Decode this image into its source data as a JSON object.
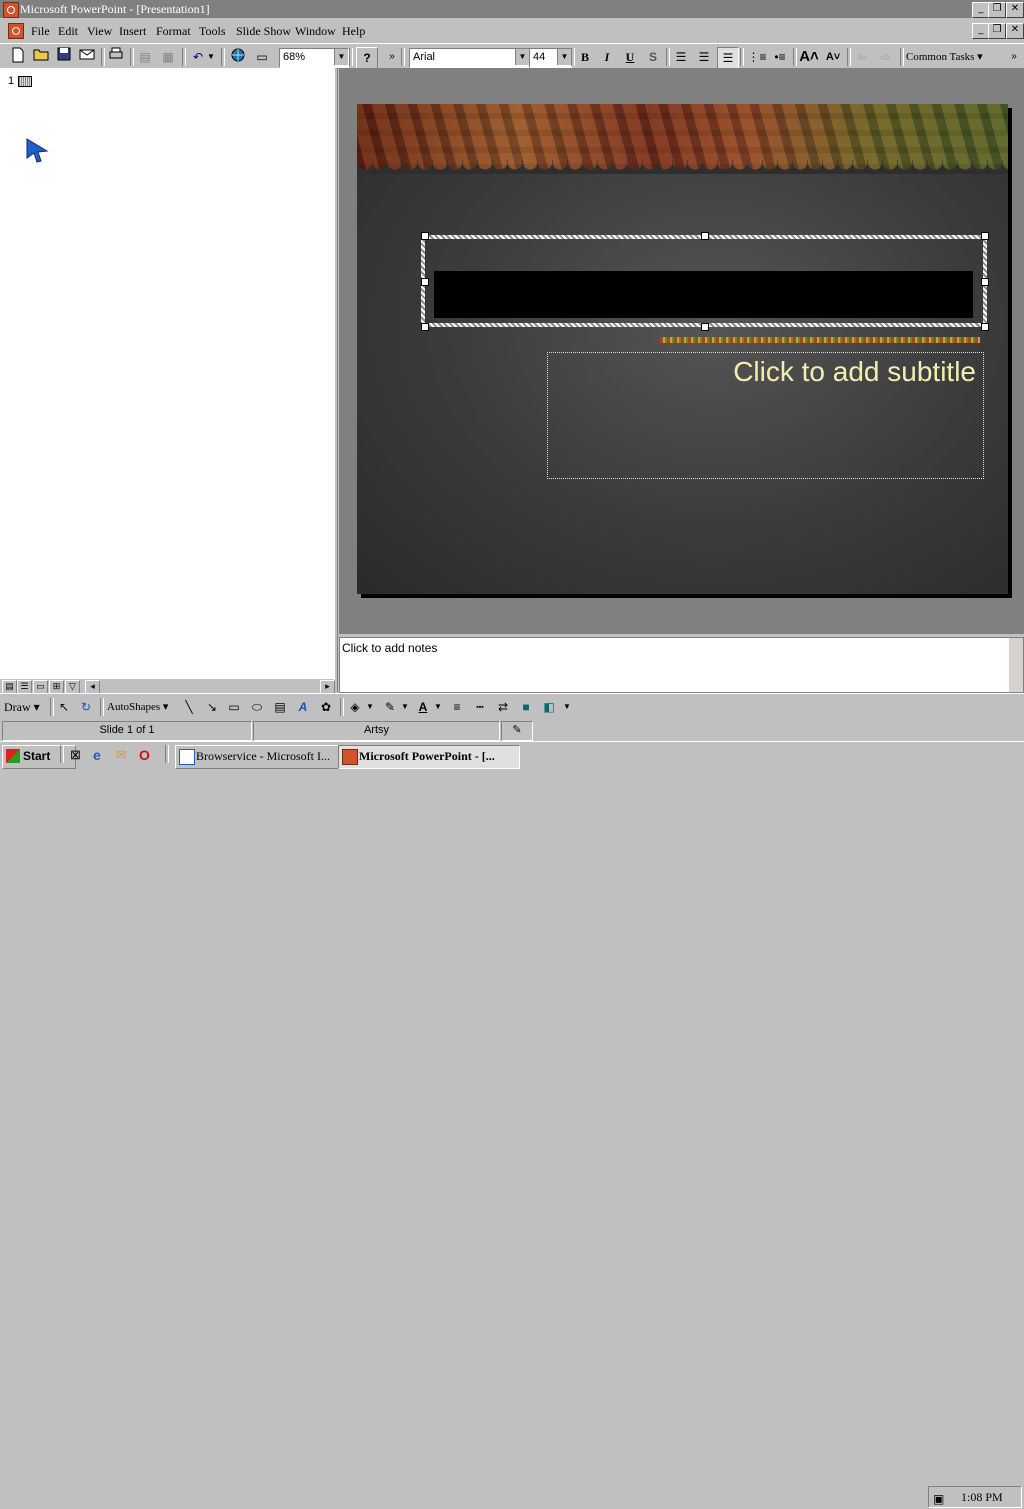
{
  "window": {
    "title": "Microsoft PowerPoint - [Presentation1]",
    "minimize": "_",
    "restore": "❐",
    "close": "✕"
  },
  "menu": {
    "items": [
      "File",
      "Edit",
      "View",
      "Insert",
      "Format",
      "Tools",
      "Slide Show",
      "Window",
      "Help"
    ]
  },
  "toolbar": {
    "zoom": "68%",
    "font": "Arial",
    "font_size": "44",
    "bold": "B",
    "italic": "I",
    "underline": "U",
    "shadow": "S",
    "common_tasks": "Common Tasks ▾",
    "more": "»"
  },
  "outline": {
    "slide_number": "1"
  },
  "slide": {
    "subtitle_placeholder": "Click to add subtitle"
  },
  "notes": {
    "placeholder": "Click to add notes"
  },
  "draw_toolbar": {
    "draw_label": "Draw ▾",
    "autoshapes_label": "AutoShapes ▾"
  },
  "status": {
    "slide_info": "Slide 1 of 1",
    "design": "Artsy"
  },
  "taskbar": {
    "start": "Start",
    "tasks": [
      "Browservice - Microsoft I...",
      "Microsoft PowerPoint - [..."
    ],
    "clock": "1:08 PM"
  },
  "colors": {
    "titlebar_inactive": "#808080",
    "subtitle_text": "#f4efb0",
    "chrome": "#c0c0c0"
  }
}
